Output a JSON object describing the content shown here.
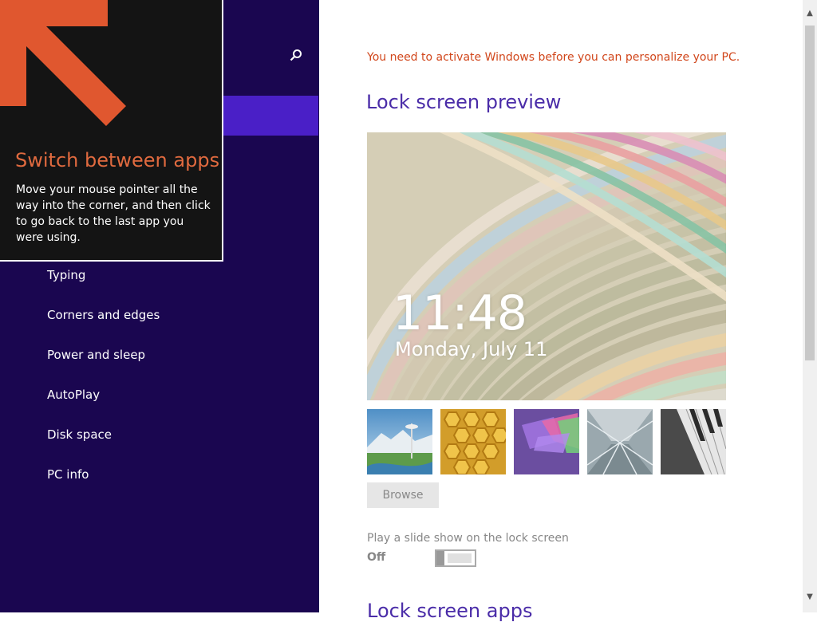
{
  "tip": {
    "title": "Switch between apps",
    "body": "Move your mouse pointer all the way into the corner, and then click to go back to the last app you were using.",
    "arrow_color": "#e0572f"
  },
  "sidebar": {
    "search_icon": "search-icon",
    "items": [
      {
        "label": "Typing"
      },
      {
        "label": "Corners and edges"
      },
      {
        "label": "Power and sleep"
      },
      {
        "label": "AutoPlay"
      },
      {
        "label": "Disk space"
      },
      {
        "label": "PC info"
      }
    ],
    "background": "#1a0650",
    "selected_color": "#4a1fc7"
  },
  "main": {
    "activation_message": "You need to activate Windows before you can personalize your PC.",
    "preview_heading": "Lock screen preview",
    "clock_time": "11:48",
    "clock_date": "Monday, July 11",
    "thumbnails": [
      "space-needle-landscape",
      "honeycomb",
      "geometric-shapes",
      "station-tunnel",
      "piano-keys"
    ],
    "browse_label": "Browse",
    "slideshow_label": "Play a slide show on the lock screen",
    "slideshow_state": "Off",
    "apps_heading": "Lock screen apps"
  }
}
